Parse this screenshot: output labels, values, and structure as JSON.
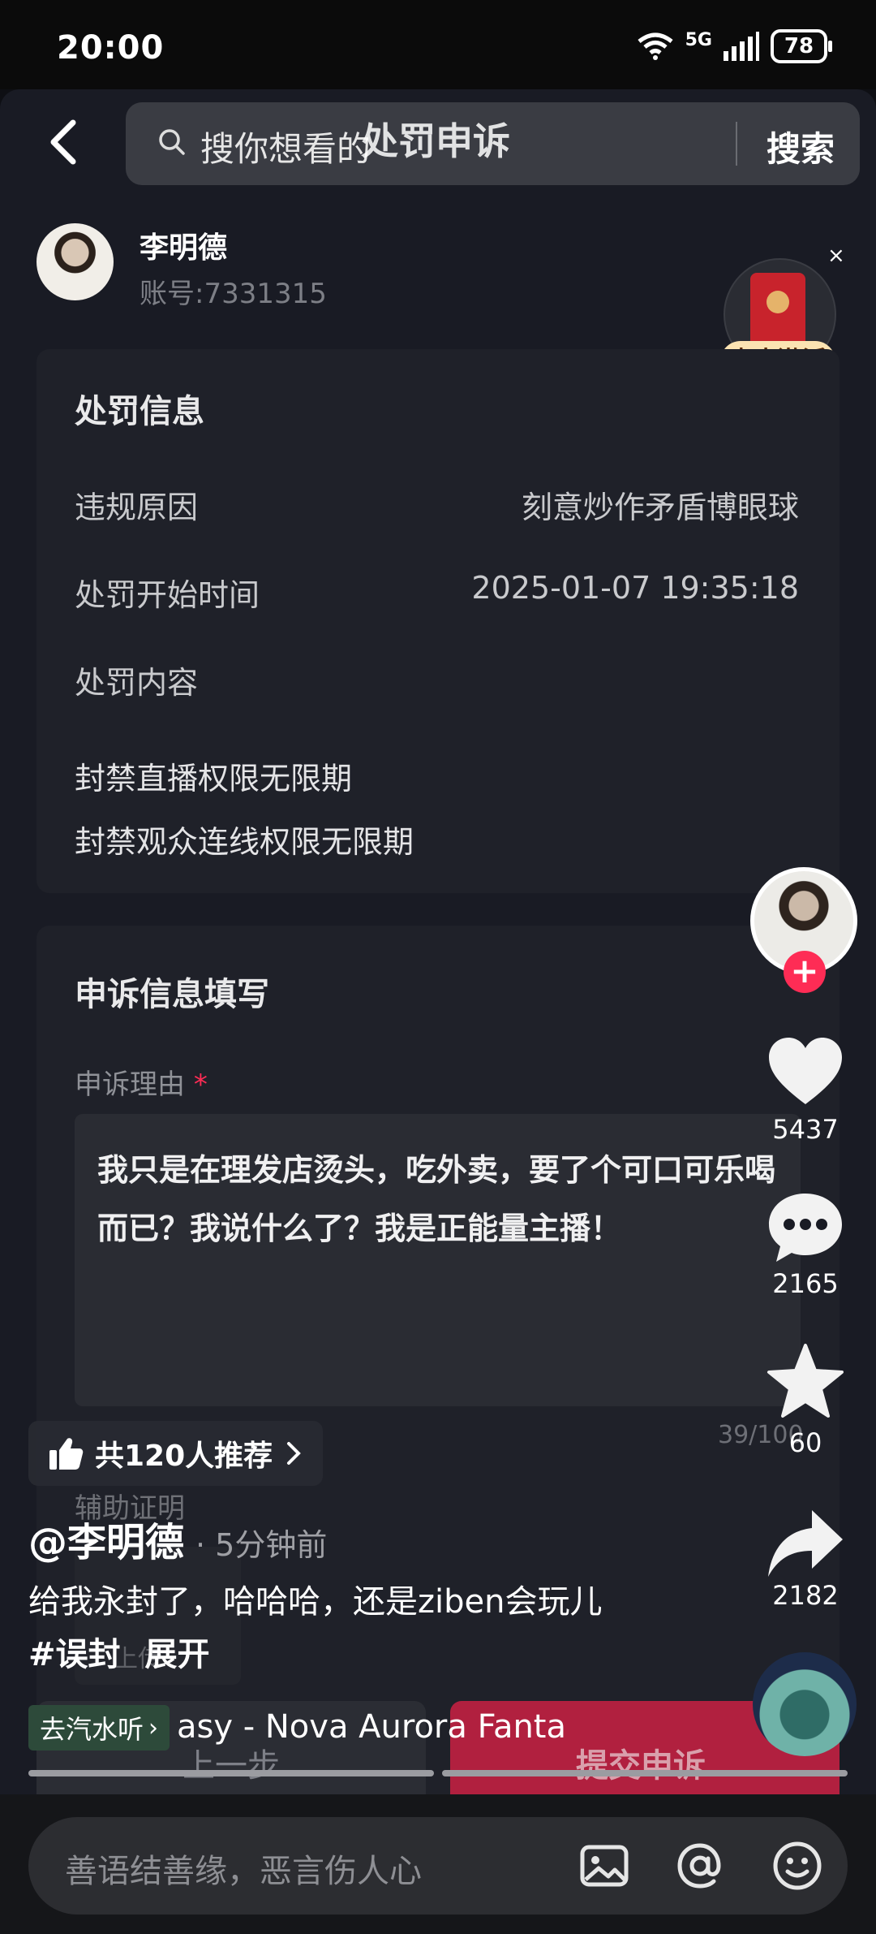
{
  "status_bar": {
    "time": "20:00",
    "network": "5G",
    "battery": "78"
  },
  "search": {
    "placeholder": "搜你想看的",
    "button": "搜索",
    "overlay_title": "处罚申诉"
  },
  "user": {
    "name": "李明德",
    "account": "账号:7331315"
  },
  "redpacket": {
    "label": "点击激活",
    "close": "×"
  },
  "penalty": {
    "title": "处罚信息",
    "rows": [
      {
        "label": "违规原因",
        "value": "刻意炒作矛盾博眼球"
      },
      {
        "label": "处罚开始时间",
        "value": "2025-01-07 19:35:18"
      }
    ],
    "content_label": "处罚内容",
    "content_items": [
      "封禁直播权限无限期",
      "封禁观众连线权限无限期"
    ]
  },
  "appeal": {
    "title": "申诉信息填写",
    "reason_label": "申诉理由",
    "required_mark": "*",
    "reason_text": "我只是在理发店烫头，吃外卖，要了个可口可乐喝而已？我说什么了？我是正能量主播！",
    "counter": "39/100",
    "proof_label": "辅助证明",
    "upload_label": "上传",
    "prev_button": "上一步",
    "submit_button": "提交申诉"
  },
  "video": {
    "likes": "5437",
    "comments": "2165",
    "favorites": "60",
    "shares": "2182",
    "recommend": "共120人推荐",
    "author": "@李明德",
    "time_ago": "· 5分钟前",
    "caption": "给我永封了，哈哈哈，还是ziben会玩儿",
    "hashtag": "#误封",
    "expand": "展开",
    "music_chip": "去汽水听",
    "music_title": "asy - Nova Aurora   Fanta"
  },
  "comment_bar": {
    "placeholder": "善语结善缘，恶言伤人心"
  },
  "colors": {
    "accent": "#fe2c55",
    "submit": "#b1203f",
    "card": "#1f2129"
  }
}
